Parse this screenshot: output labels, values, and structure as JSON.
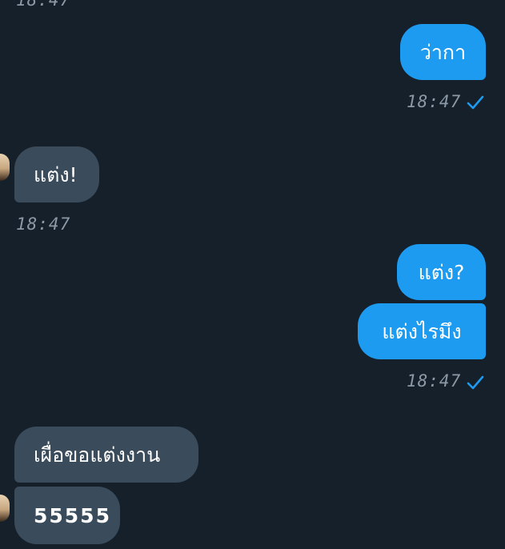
{
  "chat": {
    "top_partial_time": "18:47",
    "messages": [
      {
        "id": "m1",
        "text": "ว่ากา",
        "time": "18:47"
      },
      {
        "id": "m2",
        "text": "แต่ง!",
        "time": "18:47"
      },
      {
        "id": "m3",
        "text": "แต่ง?"
      },
      {
        "id": "m4",
        "text": "แต่งไรมึง",
        "time": "18:47"
      },
      {
        "id": "m5",
        "text": "เผื่อขอแต่งงาน"
      },
      {
        "id": "m6",
        "text": "55555"
      }
    ]
  },
  "colors": {
    "background": "#16202a",
    "outgoing_bubble": "#1d9bf0",
    "incoming_bubble": "#3a4b5c",
    "timestamp": "#8b98a5",
    "read_check": "#1d9bf0"
  },
  "icons": {
    "read_receipt": "check-icon",
    "avatar": "avatar"
  }
}
